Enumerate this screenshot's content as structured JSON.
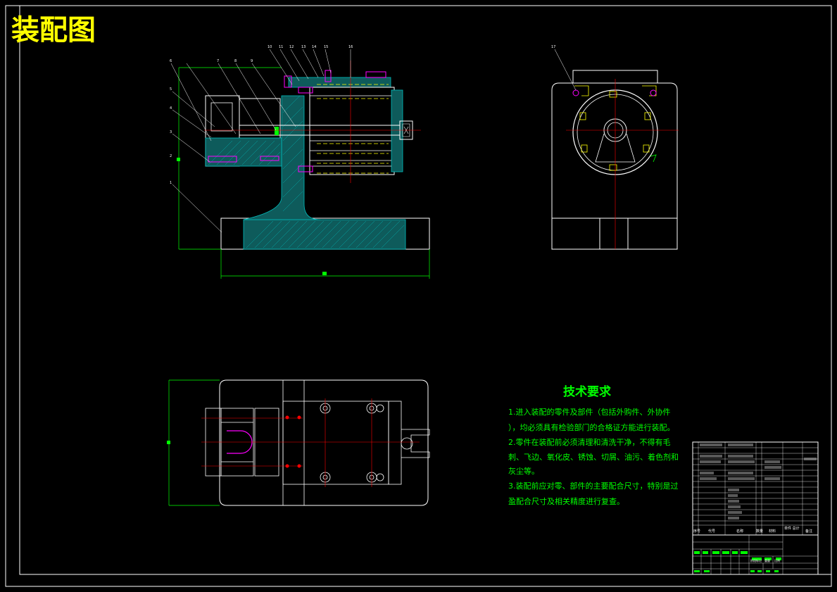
{
  "drawing": {
    "title": "装配图",
    "colors": {
      "background": "#000000",
      "outline": "#ffffff",
      "dimension": "#00ff00",
      "centerline": "#ff0000",
      "hatch": "#00bfbf",
      "title": "#ffff00",
      "highlight": "#ff00ff"
    }
  },
  "technical_requirements": {
    "title": "技术要求",
    "lines": [
      "1.进入装配的零件及部件（包括外购件、外协件",
      "），均必须具有检验部门的合格证方能进行装配。",
      "2.零件在装配前必须清理和清洗干净，不得有毛",
      "刺、飞边、氧化皮、锈蚀、切屑、油污、着色剂和",
      "灰尘等。",
      "3.装配前应对零、部件的主要配合尺寸，特别是过",
      "盈配合尺寸及相关精度进行复查。"
    ]
  },
  "balloons": {
    "front_top": [
      "10",
      "11",
      "12",
      "13",
      "14",
      "15",
      "16"
    ],
    "front_left": [
      "6",
      "5",
      "4",
      "3",
      "2",
      "1"
    ],
    "front_mid": [
      "7",
      "8",
      "9"
    ],
    "side_view": [
      "17"
    ]
  },
  "title_block": {
    "column_headers": [
      "序号",
      "代号",
      "名称",
      "数量",
      "材料",
      "单件 总计",
      "备注"
    ],
    "footer_labels": [
      "阶段标记",
      "重量",
      "比例"
    ]
  }
}
